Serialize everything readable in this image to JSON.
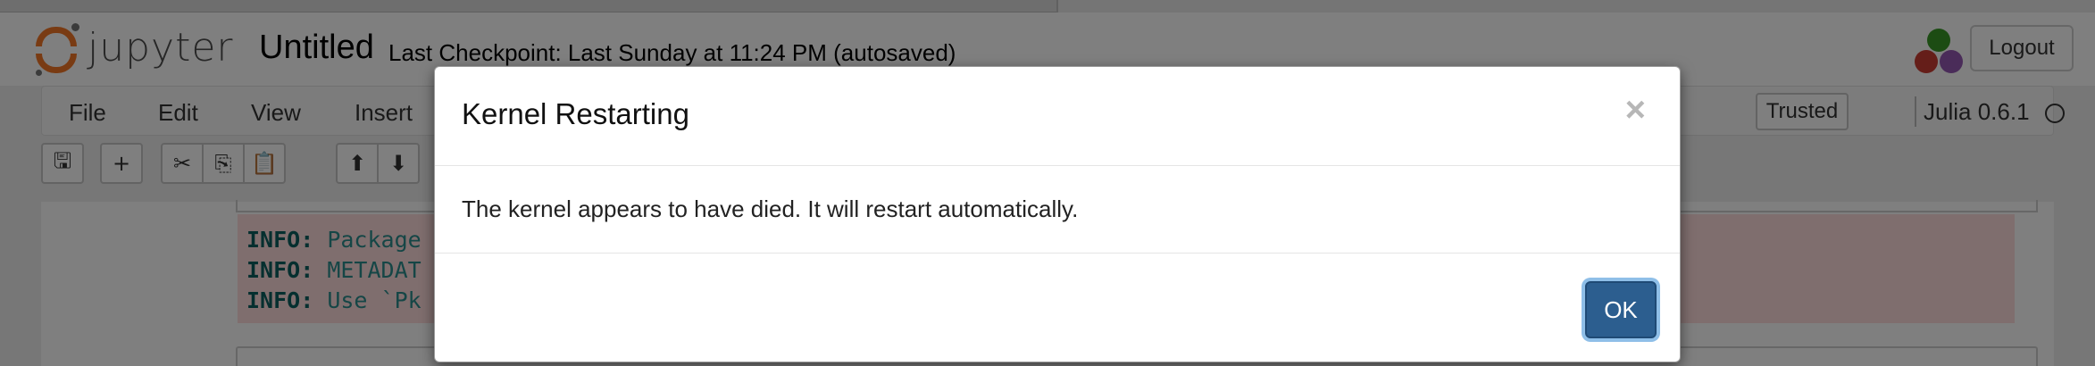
{
  "header": {
    "logo_text": "jupyter",
    "notebook_name": "Untitled",
    "checkpoint": "Last Checkpoint: Last Sunday at 11:24 PM (autosaved)",
    "logout_label": "Logout"
  },
  "menubar": {
    "items": [
      "File",
      "Edit",
      "View",
      "Insert"
    ],
    "trusted_label": "Trusted",
    "kernel_name": "Julia 0.6.1"
  },
  "toolbar": {
    "buttons": [
      {
        "icon": "save-icon",
        "glyph": "🖫"
      },
      {
        "icon": "plus-icon",
        "glyph": "+"
      },
      {
        "icon": "cut-icon",
        "glyph": "✂"
      },
      {
        "icon": "copy-icon",
        "glyph": "⎘"
      },
      {
        "icon": "paste-icon",
        "glyph": "📋"
      },
      {
        "icon": "arrow-up-icon",
        "glyph": "⬆"
      },
      {
        "icon": "arrow-down-icon",
        "glyph": "⬇"
      }
    ]
  },
  "output": {
    "lines": [
      {
        "key": "INFO:",
        "value": "Package"
      },
      {
        "key": "INFO:",
        "value": "METADAT"
      },
      {
        "key": "INFO:",
        "value": "Use `Pk"
      }
    ]
  },
  "modal": {
    "title": "Kernel Restarting",
    "close_glyph": "×",
    "body": "The kernel appears to have died. It will restart automatically.",
    "ok_label": "OK"
  },
  "colors": {
    "jupyter_orange": "#f37726",
    "ok_button": "#2c5e8f",
    "stderr_background": "#ffdddd",
    "julia_green": "#389826",
    "julia_red": "#cb3c33",
    "julia_purple": "#9558b2"
  }
}
